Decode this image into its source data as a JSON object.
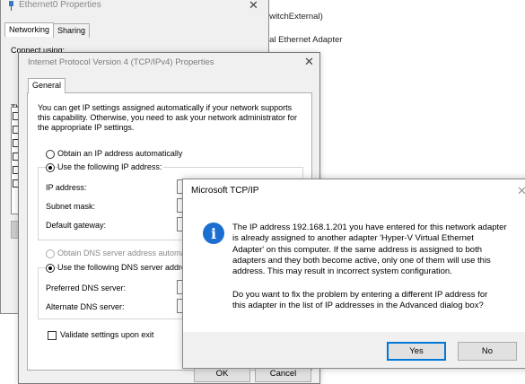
{
  "background": {
    "line1": "vSwitchExternal)",
    "line2": "rtual Ethernet Adapter"
  },
  "ethernet_window": {
    "title": "Ethernet0 Properties",
    "close": "✕",
    "tabs": [
      "Networking",
      "Sharing"
    ],
    "connect_label": "Connect using:",
    "this_label": "Th",
    "d_label": "D"
  },
  "ipv4_dialog": {
    "title": "Internet Protocol Version 4 (TCP/IPv4) Properties",
    "close": "✕",
    "tab": "General",
    "intro": "You can get IP settings assigned automatically if your network supports this capability. Otherwise, you need to ask your network administrator for the appropriate IP settings.",
    "obtain_ip": "Obtain an IP address automatically",
    "use_ip": "Use the following IP address:",
    "ip_label": "IP address:",
    "subnet_label": "Subnet mask:",
    "gateway_label": "Default gateway:",
    "obtain_dns": "Obtain DNS server address automatically",
    "use_dns": "Use the following DNS server addresses:",
    "preferred_dns": "Preferred DNS server:",
    "alternate_dns": "Alternate DNS server:",
    "validate": "Validate settings upon exit",
    "ok": "OK",
    "cancel": "Cancel"
  },
  "message_box": {
    "title": "Microsoft TCP/IP",
    "close": "✕",
    "icon": "info-icon",
    "icon_glyph": "i",
    "para1_lines": [
      "The IP address 192.168.1.201 you have entered for this network adapter",
      "is already assigned to another adapter 'Hyper-V Virtual Ethernet",
      "Adapter' on this computer. If the same address is assigned to both",
      "adapters and they both become active, only one of them will use this",
      "address. This may result in incorrect system configuration."
    ],
    "para2_lines": [
      "Do you want to fix the problem by entering a different IP address for",
      "this adapter in the list of IP addresses in the Advanced dialog box?"
    ],
    "yes": "Yes",
    "no": "No"
  },
  "colors": {
    "accent": "#0078d7",
    "info_icon": "#1c6fd1",
    "dialog_bg": "#f0f0f0"
  }
}
